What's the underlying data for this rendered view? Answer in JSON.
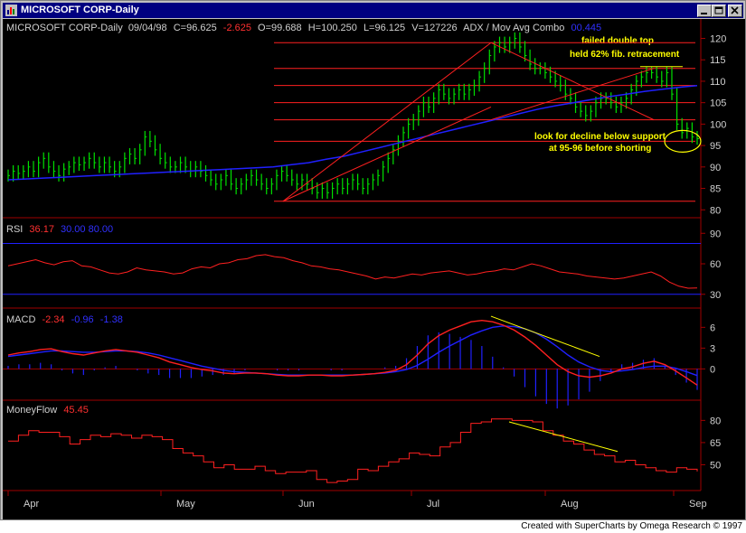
{
  "window": {
    "title": "MICROSOFT CORP-Daily",
    "controls": [
      "minimize-icon",
      "maximize-icon",
      "close-icon"
    ]
  },
  "colors": {
    "background": "#000000",
    "price_bars": "#00e000",
    "moving_average": "#2020ff",
    "trend_lines": "#ff2020",
    "annotation": "#ffff00",
    "axis_text": "#d0d0d0",
    "titlebar": "#000080"
  },
  "header": {
    "symbol": "MICROSOFT CORP-Daily",
    "date": "09/04/98",
    "close": "C=96.625",
    "change": "-2.625",
    "open": "O=99.688",
    "high": "H=100.250",
    "low": "L=96.125",
    "volume": "V=127226",
    "indicator": "ADX / Mov Avg Combo",
    "indicator_value": "00.445"
  },
  "panels": {
    "rsi": {
      "label": "RSI",
      "value": "36.17",
      "levels": "30.00 80.00"
    },
    "macd": {
      "label": "MACD",
      "value": "-2.34",
      "signal": "-0.96",
      "hist": "-1.38"
    },
    "moneyflow": {
      "label": "MoneyFlow",
      "value": "45.45"
    }
  },
  "annotations": {
    "failed_top_line1": "failed double top",
    "failed_top_line2": "held 62% fib. retracement",
    "support_line1": "look for decline below support",
    "support_line2": "at 95-96 before shorting"
  },
  "months": [
    "Apr",
    "May",
    "Jun",
    "Jul",
    "Aug",
    "Sep"
  ],
  "footer": "Created with SuperCharts by Omega Research © 1997",
  "chart_data": [
    {
      "type": "ohlc",
      "title": "MICROSOFT CORP-Daily",
      "ylim": [
        79,
        122
      ],
      "y_ticks": [
        80,
        85,
        90,
        95,
        100,
        105,
        110,
        115,
        120
      ],
      "horizontal_levels": [
        82,
        96,
        101,
        105,
        109,
        113,
        119
      ],
      "closes": [
        88,
        89,
        88.5,
        89,
        90,
        89,
        91,
        92,
        90,
        89,
        88,
        89.5,
        90,
        91,
        90.5,
        91,
        92,
        91,
        90,
        91,
        90,
        89,
        90,
        92,
        93,
        92,
        94,
        97,
        96,
        94,
        92,
        91,
        90,
        90,
        91,
        90,
        89,
        90,
        89,
        88,
        87,
        86,
        87,
        88,
        86,
        85,
        86,
        87,
        88,
        87,
        86,
        85,
        86,
        88,
        89,
        88,
        87,
        86,
        87,
        86,
        85,
        84,
        85,
        84,
        85,
        86,
        85,
        86,
        87,
        86,
        85,
        86,
        87,
        88,
        90,
        92,
        94,
        96,
        98,
        100,
        101,
        103,
        105,
        104,
        106,
        108,
        107,
        106,
        107,
        108,
        107,
        108,
        109,
        111,
        113,
        116,
        118,
        119,
        118,
        119,
        120,
        118,
        116,
        114,
        113,
        113,
        112,
        111,
        110,
        109,
        107,
        106,
        104,
        103,
        102,
        103,
        105,
        106,
        106,
        105,
        104,
        105,
        106,
        108,
        110,
        111,
        112,
        112,
        111,
        110,
        112,
        107,
        100,
        98,
        99,
        97,
        96.6
      ],
      "moving_average": [
        87,
        87.2,
        87.4,
        87.6,
        87.8,
        88,
        88.2,
        88.4,
        88.6,
        88.8,
        89,
        89.2,
        89.4,
        89.6,
        89.8,
        90,
        90.5,
        91,
        91.8,
        92.5,
        93.5,
        94.5,
        95.5,
        96.5,
        97.5,
        98.5,
        99.5,
        100.5,
        101.5,
        102.5,
        103.5,
        104.3,
        105,
        105.7,
        106.4,
        107,
        107.6,
        108.1,
        108.6,
        109
      ],
      "annotation_failed_top": "failed double top",
      "annotation_support": "look for decline below support"
    },
    {
      "type": "line",
      "title": "RSI",
      "ylim": [
        20,
        100
      ],
      "y_ticks": [
        30,
        60,
        90
      ],
      "reference_levels": [
        30,
        80
      ],
      "values": [
        58,
        60,
        62,
        64,
        61,
        59,
        62,
        63,
        58,
        57,
        54,
        51,
        50,
        52,
        56,
        54,
        53,
        52,
        50,
        51,
        55,
        57,
        56,
        60,
        61,
        64,
        65,
        68,
        69,
        67,
        66,
        63,
        61,
        58,
        57,
        55,
        54,
        52,
        50,
        48,
        45,
        47,
        46,
        48,
        50,
        49,
        51,
        52,
        53,
        51,
        49,
        50,
        52,
        53,
        55,
        54,
        57,
        60,
        58,
        55,
        52,
        51,
        50,
        48,
        47,
        46,
        45,
        46,
        48,
        50,
        52,
        48,
        42,
        38,
        36,
        36.17
      ]
    },
    {
      "type": "line",
      "title": "MACD",
      "ylim": [
        -4,
        8
      ],
      "y_ticks": [
        0,
        3,
        6
      ],
      "series": [
        {
          "name": "MACD",
          "values": [
            2,
            2.3,
            2.5,
            2.8,
            2.9,
            2.5,
            2.2,
            2,
            2.3,
            2.6,
            2.8,
            2.6,
            2.4,
            2,
            1.6,
            1,
            0.6,
            0.2,
            -0.1,
            -0.3,
            -0.6,
            -0.7,
            -0.6,
            -0.6,
            -0.7,
            -0.9,
            -1,
            -1,
            -0.9,
            -0.9,
            -1,
            -1,
            -0.9,
            -0.8,
            -0.7,
            -0.5,
            -0.2,
            0.6,
            2,
            3.6,
            4.8,
            5.6,
            6.2,
            6.8,
            7,
            6.8,
            6.3,
            5.6,
            4.6,
            3.4,
            2,
            0.6,
            -0.4,
            -1,
            -1.2,
            -1,
            -0.6,
            0,
            0.3,
            0.8,
            1.1,
            0.6,
            -0.3,
            -1.3,
            -2.34
          ]
        },
        {
          "name": "Signal",
          "values": [
            1.8,
            2,
            2.2,
            2.4,
            2.6,
            2.6,
            2.5,
            2.4,
            2.4,
            2.5,
            2.6,
            2.6,
            2.5,
            2.3,
            2,
            1.6,
            1.2,
            0.8,
            0.4,
            0.1,
            -0.2,
            -0.4,
            -0.5,
            -0.6,
            -0.7,
            -0.8,
            -0.9,
            -0.9,
            -0.9,
            -0.9,
            -0.9,
            -0.9,
            -0.9,
            -0.8,
            -0.7,
            -0.6,
            -0.4,
            -0.1,
            0.5,
            1.4,
            2.4,
            3.3,
            4.1,
            4.9,
            5.5,
            6,
            6.2,
            6.1,
            5.8,
            5.2,
            4.3,
            3.2,
            2,
            1,
            0.3,
            -0.2,
            -0.4,
            -0.3,
            -0.1,
            0.2,
            0.4,
            0.4,
            0.1,
            -0.4,
            -0.96
          ]
        }
      ]
    },
    {
      "type": "line",
      "title": "MoneyFlow",
      "ylim": [
        35,
        90
      ],
      "y_ticks": [
        50,
        65,
        80
      ],
      "values": [
        66,
        70,
        73,
        72,
        72,
        69,
        64,
        67,
        70,
        69,
        71,
        70,
        68,
        70,
        69,
        67,
        61,
        58,
        56,
        52,
        48,
        50,
        47,
        47,
        49,
        46,
        44,
        45,
        45,
        46,
        40,
        38,
        39,
        40,
        47,
        46,
        49,
        52,
        54,
        58,
        57,
        56,
        62,
        65,
        72,
        78,
        79,
        81,
        81,
        80,
        80,
        79,
        73,
        70,
        66,
        64,
        60,
        57,
        56,
        52,
        53,
        50,
        48,
        46,
        45,
        48,
        47,
        45.45
      ]
    }
  ]
}
